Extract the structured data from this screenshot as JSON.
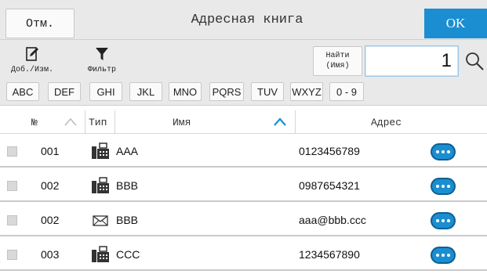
{
  "header": {
    "cancel_label": "Отм.",
    "title": "Адресная книга",
    "ok_label": "OK"
  },
  "toolbar": {
    "add_edit_label": "Доб./Изм.",
    "filter_label": "Фильтр",
    "find_label_line1": "Найти",
    "find_label_line2": "(Имя)",
    "search_value": "1",
    "letter_buttons": [
      "ABC",
      "DEF",
      "GHI",
      "JKL",
      "MNO",
      "PQRS",
      "TUV",
      "WXYZ",
      "0 - 9"
    ]
  },
  "table": {
    "columns": {
      "number": "№",
      "type": "Тип",
      "name": "Имя",
      "address": "Адрес"
    },
    "sort_column": "name",
    "rows": [
      {
        "number": "001",
        "type_icon": "fax-icon",
        "name": "AAA",
        "address": "0123456789"
      },
      {
        "number": "002",
        "type_icon": "fax-icon",
        "name": "BBB",
        "address": "0987654321"
      },
      {
        "number": "002",
        "type_icon": "email-icon",
        "name": "BBB",
        "address": "aaa@bbb.ccc"
      },
      {
        "number": "003",
        "type_icon": "fax-icon",
        "name": "CCC",
        "address": "1234567890"
      }
    ]
  },
  "colors": {
    "accent": "#1a8ed1",
    "bar_background": "#e9e9e9"
  }
}
